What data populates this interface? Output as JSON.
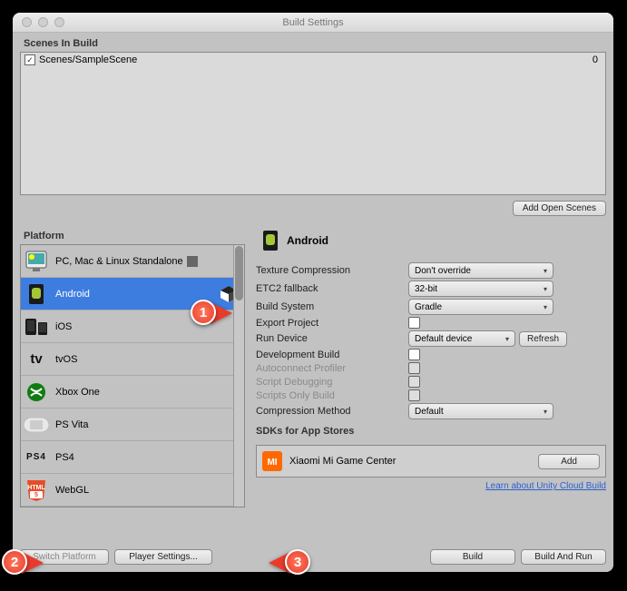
{
  "window": {
    "title": "Build Settings"
  },
  "scenes": {
    "heading": "Scenes In Build",
    "item_label": "Scenes/SampleScene",
    "item_index": "0",
    "add_open": "Add Open Scenes"
  },
  "platform_heading": "Platform",
  "platforms": {
    "pc": "PC, Mac & Linux Standalone",
    "android": "Android",
    "ios": "iOS",
    "tvos": "tvOS",
    "xbox": "Xbox One",
    "psvita": "PS Vita",
    "ps4": "PS4",
    "webgl": "WebGL"
  },
  "details": {
    "title": "Android",
    "fields": {
      "texcomp": {
        "label": "Texture Compression",
        "value": "Don't override"
      },
      "etc2": {
        "label": "ETC2 fallback",
        "value": "32-bit"
      },
      "buildsys": {
        "label": "Build System",
        "value": "Gradle"
      },
      "export": {
        "label": "Export Project"
      },
      "rundev": {
        "label": "Run Device",
        "value": "Default device",
        "refresh": "Refresh"
      },
      "devbuild": {
        "label": "Development Build"
      },
      "autoprof": {
        "label": "Autoconnect Profiler"
      },
      "scriptdbg": {
        "label": "Script Debugging"
      },
      "scriptsonly": {
        "label": "Scripts Only Build"
      },
      "compmeth": {
        "label": "Compression Method",
        "value": "Default"
      }
    },
    "sdk_heading": "SDKs for App Stores",
    "sdk_item": "Xiaomi Mi Game Center",
    "sdk_add": "Add",
    "cloud_link": "Learn about Unity Cloud Build"
  },
  "footer": {
    "switch": "Switch Platform",
    "player": "Player Settings...",
    "build": "Build",
    "build_run": "Build And Run"
  },
  "callouts": {
    "one": "1",
    "two": "2",
    "three": "3"
  }
}
